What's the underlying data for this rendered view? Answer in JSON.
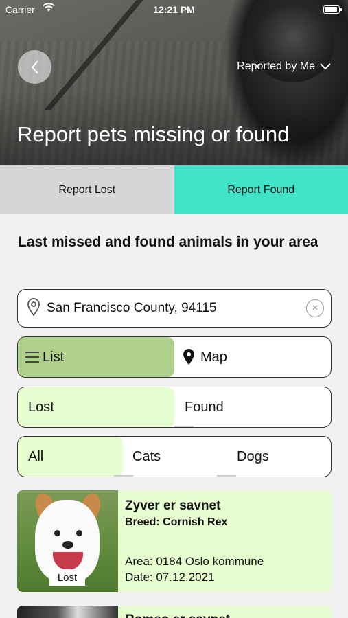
{
  "status_bar": {
    "carrier": "Carrier",
    "time": "12:21 PM"
  },
  "header": {
    "filter_label": "Reported by Me",
    "title": "Report pets missing or found"
  },
  "report_tabs": {
    "lost": "Report Lost",
    "found": "Report Found"
  },
  "section": {
    "title": "Last missed and found animals in your area"
  },
  "search": {
    "value": "San Francisco County, 94115",
    "clear_symbol": "×"
  },
  "view_toggle": {
    "list": "List",
    "map": "Map",
    "selected": "List"
  },
  "status_toggle": {
    "lost": "Lost",
    "found": "Found",
    "selected": "Lost"
  },
  "type_toggle": {
    "all": "All",
    "cats": "Cats",
    "dogs": "Dogs",
    "selected": "All"
  },
  "results": [
    {
      "name": "Zyver er savnet",
      "breed": "Breed: Cornish Rex",
      "area": "Area: 0184 Oslo kommune",
      "date": "Date: 07.12.2021",
      "badge": "Lost"
    },
    {
      "name": "Romeo er savnet"
    }
  ],
  "colors": {
    "report_found_bg": "#40e3c8",
    "report_lost_bg": "#d6d6d6",
    "selected_list_bg": "#aed08a",
    "selected_light_bg": "#e6fdd0"
  }
}
